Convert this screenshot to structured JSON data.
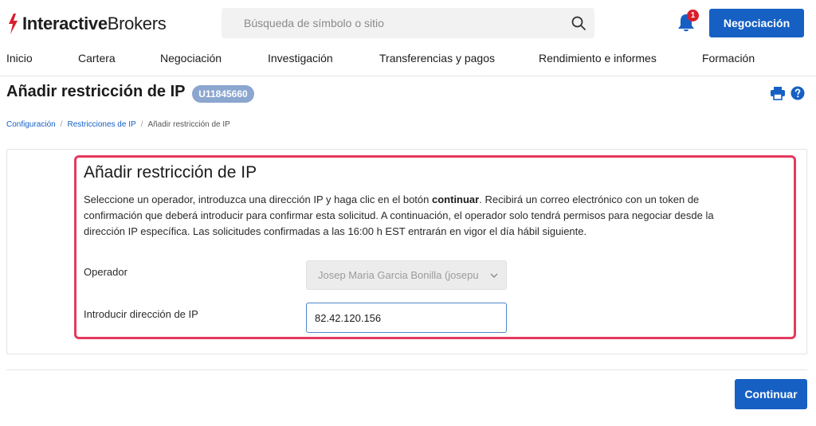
{
  "brand": {
    "logo_bold": "Interactive",
    "logo_regular": "Brokers",
    "logo_color": "#d81e2c"
  },
  "header": {
    "search_placeholder": "Búsqueda de símbolo o sitio",
    "search_icon": "search-icon",
    "notifications_icon": "bell-icon",
    "notifications_count": "1",
    "trade_button": "Negociación",
    "accent_color": "#1660c4"
  },
  "nav": {
    "items": [
      {
        "label": "Inicio"
      },
      {
        "label": "Cartera"
      },
      {
        "label": "Negociación"
      },
      {
        "label": "Investigación"
      },
      {
        "label": "Transferencias y pagos"
      },
      {
        "label": "Rendimiento e informes"
      },
      {
        "label": "Formación"
      }
    ]
  },
  "page": {
    "title": "Añadir restricción de IP",
    "account_id": "U11845660",
    "print_icon": "printer-icon",
    "help_icon": "help-icon"
  },
  "breadcrumb": {
    "items": [
      "Configuración",
      "Restricciones de IP",
      "Añadir restricción de IP"
    ]
  },
  "form": {
    "title": "Añadir restricción de IP",
    "desc_part1": "Seleccione un operador, introduzca una dirección IP y haga clic en el botón ",
    "desc_bold": "continuar",
    "desc_part2": ". Recibirá un correo electrónico con un token de confirmación que deberá introducir para confirmar esta solicitud. A continuación, el operador solo tendrá permisos para negociar desde la dirección IP específica. Las solicitudes confirmadas a las 16:00 h EST entrarán en vigor el día hábil siguiente.",
    "operator_label": "Operador",
    "operator_value": "Josep Maria Garcia Bonilla (josepu",
    "ip_label": "Introducir dirección de IP",
    "ip_value": "82.42.120.156",
    "highlight_color": "#e4395e"
  },
  "footer": {
    "continue_button": "Continuar"
  }
}
